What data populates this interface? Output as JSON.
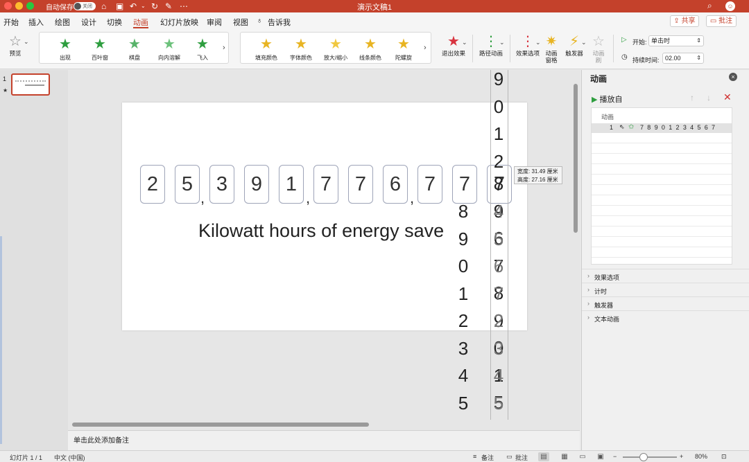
{
  "titlebar": {
    "autosave": "自动保存",
    "toggle": "关闭",
    "title": "演示文稿1"
  },
  "menu": {
    "tabs": [
      "开始",
      "插入",
      "绘图",
      "设计",
      "切换",
      "动画",
      "幻灯片放映",
      "审阅",
      "视图"
    ],
    "active_tab": "动画",
    "tell_me": "告诉我",
    "share": "共享",
    "comments": "批注"
  },
  "ribbon": {
    "preview": "预览",
    "entrance": [
      "出现",
      "百叶窗",
      "棋盘",
      "向内溶解",
      "飞入"
    ],
    "emphasis": [
      "填充颜色",
      "字体颜色",
      "放大/缩小",
      "线条颜色",
      "陀螺旋"
    ],
    "exit_effects": "退出效果",
    "path_anim": "路径动画",
    "effect_options": "效果选项",
    "anim_pane": "动画\n窗格",
    "trigger": "触发器",
    "anim_brush": "动画\n刷",
    "start_label": "开始:",
    "start_value": "单击时",
    "duration_label": "持续时间:",
    "duration_value": "02.00"
  },
  "thumbs": {
    "slide_number": "1"
  },
  "slide": {
    "digits": [
      "2",
      "5",
      "3",
      "9",
      "1",
      "7",
      "7",
      "6",
      "7",
      "7",
      "7"
    ],
    "commas": [
      ",",
      ",",
      ","
    ],
    "caption": "Kilowatt hours of energy save",
    "column_a": [
      "8",
      "9",
      "0",
      "1",
      "2",
      "3",
      "4",
      "5"
    ],
    "column_b_top": [
      "9",
      "0",
      "1",
      "2"
    ],
    "column_b_bottom": [
      "8",
      "9",
      "6",
      "7",
      "8",
      "9",
      "0",
      "1",
      "5"
    ],
    "column_b_ghost": [
      "4",
      "5",
      "6",
      "7",
      "2",
      "3",
      "4",
      "5"
    ],
    "size_tip_width": "宽度: 31.49 厘米",
    "size_tip_height": "高度: 27.16 厘米"
  },
  "notes": {
    "placeholder": "单击此处添加备注"
  },
  "pane": {
    "title": "动画",
    "play": "播放自",
    "list_header": "动画",
    "row_index": "1",
    "row_text": "7 8 9 0 1 2 3 4 5 6 7",
    "sections": [
      "效果选项",
      "计时",
      "触发器",
      "文本动画"
    ]
  },
  "status": {
    "slide": "幻灯片 1 / 1",
    "language": "中文 (中国)",
    "notes": "备注",
    "comments": "批注",
    "zoom": "80%"
  }
}
